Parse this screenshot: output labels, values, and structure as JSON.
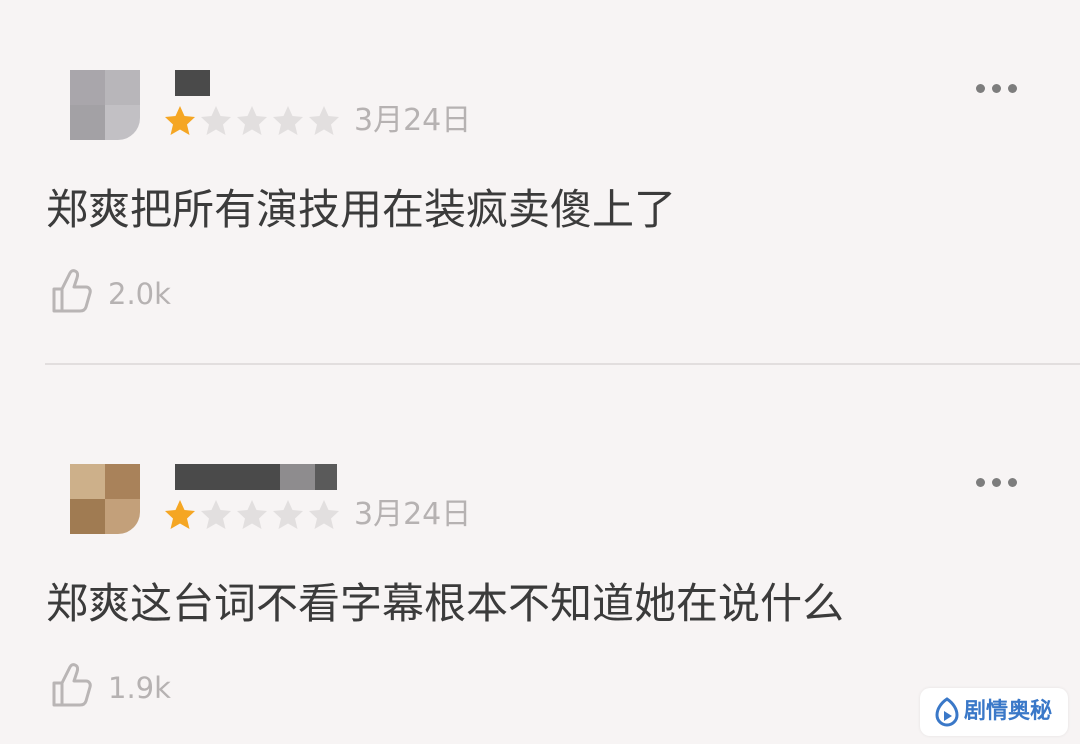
{
  "comments": [
    {
      "rating": 1,
      "rating_max": 5,
      "date": "3月24日",
      "text": "郑爽把所有演技用在装疯卖傻上了",
      "likes": "2.0k"
    },
    {
      "rating": 1,
      "rating_max": 5,
      "date": "3月24日",
      "text": "郑爽这台词不看字幕根本不知道她在说什么",
      "likes": "1.9k"
    }
  ],
  "icons": {
    "star": "star-icon",
    "more": "more-dots-icon",
    "like": "thumbs-up-icon",
    "watermark": "play-logo-icon"
  },
  "colors": {
    "star_filled": "#f5a623",
    "star_empty": "#e2dfdf",
    "meta_text": "#b6b2b2",
    "watermark_text": "#3a78c8"
  },
  "watermark": {
    "label": "剧情奥秘"
  }
}
